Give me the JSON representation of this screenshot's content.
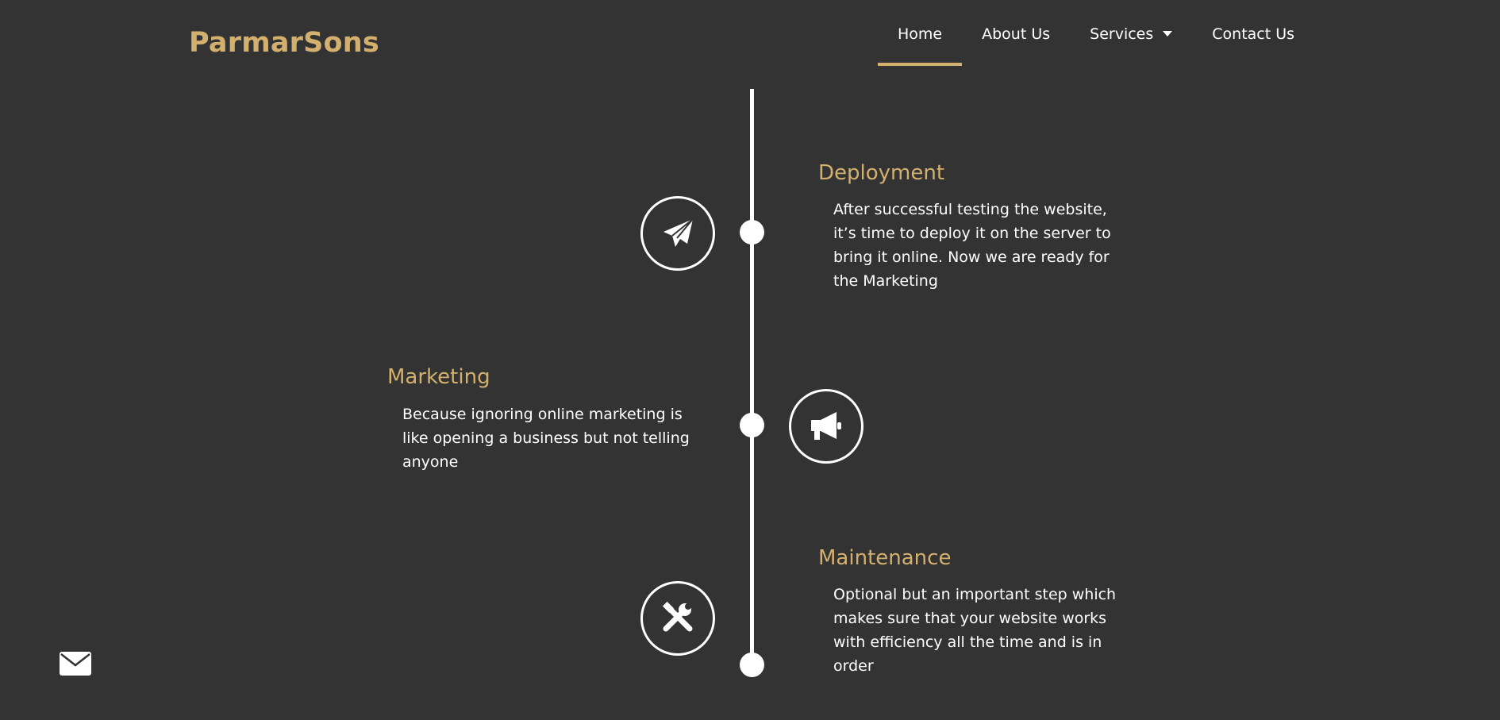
{
  "brand": {
    "name": "ParmarSons",
    "accent_color": "#d4b06e"
  },
  "nav": {
    "items": [
      {
        "label": "Home",
        "active": true
      },
      {
        "label": "About Us"
      },
      {
        "label": "Services",
        "has_dropdown": true
      },
      {
        "label": "Contact Us"
      }
    ]
  },
  "timeline": {
    "steps": [
      {
        "title": "Deployment",
        "text": "After successful testing the website, it’s time to deploy it on the server to bring it online. Now we are ready for the Marketing",
        "icon": "paper-plane-icon"
      },
      {
        "title": "Marketing",
        "text": "Because ignoring online marketing is like opening a business but not telling anyone",
        "icon": "megaphone-icon"
      },
      {
        "title": "Maintenance",
        "text": "Optional but an important step which makes sure that your website works with efficiency all the time and is in order",
        "icon": "tools-icon"
      }
    ]
  },
  "floating": {
    "icon": "envelope-icon"
  },
  "colors": {
    "background": "#333333",
    "text": "#ffffff",
    "accent": "#d4b06e"
  }
}
